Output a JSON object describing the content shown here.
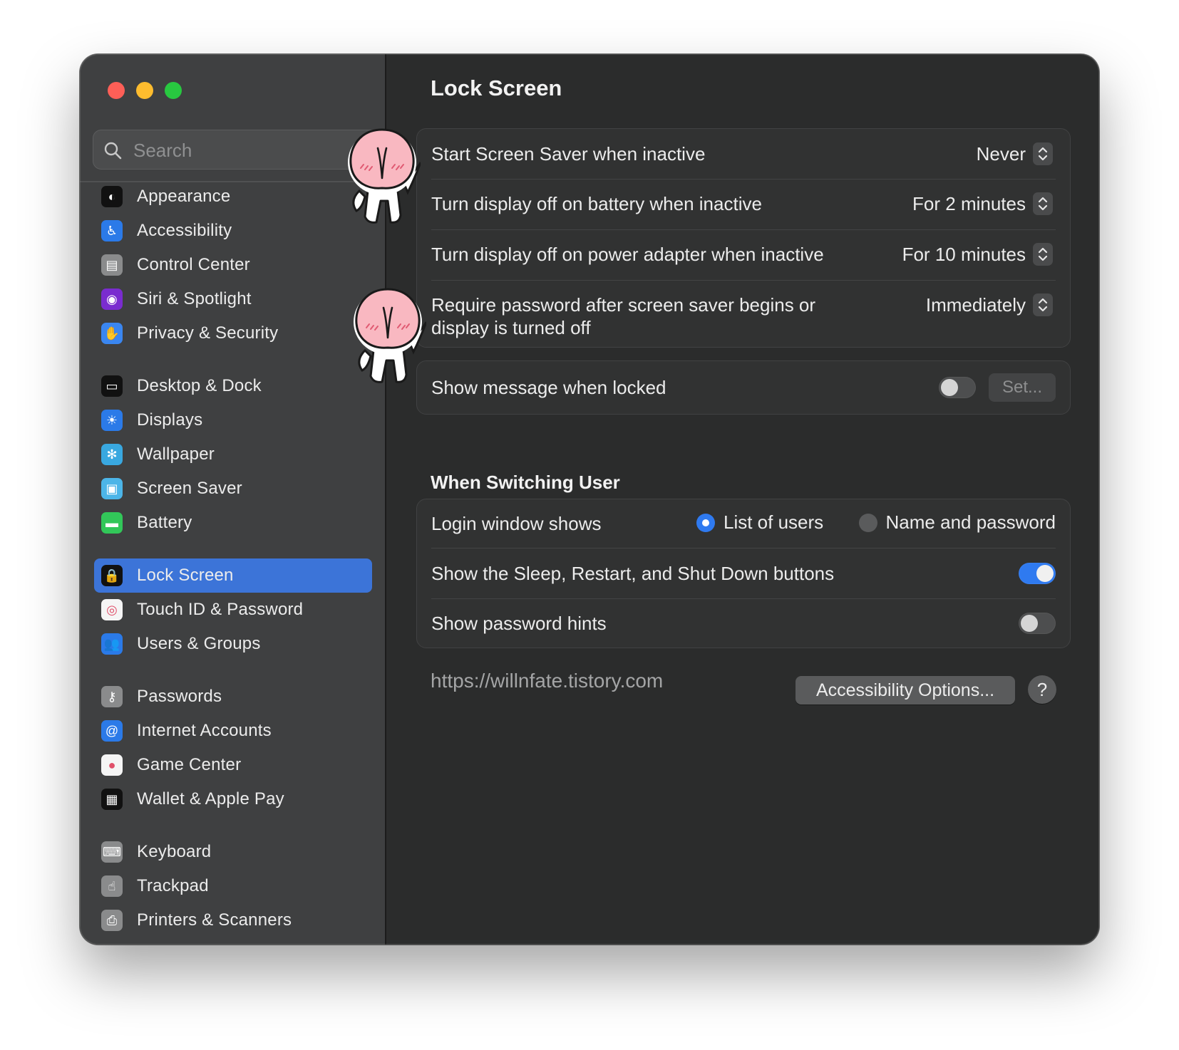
{
  "window": {
    "traffic_lights": [
      "close",
      "minimize",
      "zoom"
    ]
  },
  "sidebar": {
    "search_placeholder": "Search",
    "items": [
      {
        "label": "Appearance",
        "icon": "appearance-icon",
        "color": "#111111"
      },
      {
        "label": "Accessibility",
        "icon": "accessibility-icon",
        "color": "#2b7ae8"
      },
      {
        "label": "Control Center",
        "icon": "control-center-icon",
        "color": "#8a8b8c"
      },
      {
        "label": "Siri & Spotlight",
        "icon": "siri-icon",
        "color": "#7a2ccf"
      },
      {
        "label": "Privacy & Security",
        "icon": "hand-icon",
        "color": "#3a86f0"
      },
      {
        "label": "Desktop & Dock",
        "icon": "dock-icon",
        "color": "#111111"
      },
      {
        "label": "Displays",
        "icon": "sun-icon",
        "color": "#2b7ae8"
      },
      {
        "label": "Wallpaper",
        "icon": "snowflake-icon",
        "color": "#39a8e0"
      },
      {
        "label": "Screen Saver",
        "icon": "screen-saver-icon",
        "color": "#4cb5e8"
      },
      {
        "label": "Battery",
        "icon": "battery-icon",
        "color": "#32c759"
      },
      {
        "label": "Lock Screen",
        "icon": "lock-icon",
        "color": "#111111"
      },
      {
        "label": "Touch ID & Password",
        "icon": "fingerprint-icon",
        "color": "#f5f5f5"
      },
      {
        "label": "Users & Groups",
        "icon": "users-icon",
        "color": "#2b7ae8"
      },
      {
        "label": "Passwords",
        "icon": "key-icon",
        "color": "#8a8b8c"
      },
      {
        "label": "Internet Accounts",
        "icon": "at-icon",
        "color": "#2b7ae8"
      },
      {
        "label": "Game Center",
        "icon": "game-center-icon",
        "color": "#f5f5f5"
      },
      {
        "label": "Wallet & Apple Pay",
        "icon": "wallet-icon",
        "color": "#111111"
      },
      {
        "label": "Keyboard",
        "icon": "keyboard-icon",
        "color": "#8a8b8c"
      },
      {
        "label": "Trackpad",
        "icon": "trackpad-icon",
        "color": "#8a8b8c"
      },
      {
        "label": "Printers & Scanners",
        "icon": "printer-icon",
        "color": "#8a8b8c"
      }
    ],
    "active": "Lock Screen"
  },
  "main": {
    "title": "Lock Screen",
    "settings": [
      {
        "label": "Start Screen Saver when inactive",
        "value": "Never"
      },
      {
        "label": "Turn display off on battery when inactive",
        "value": "For 2 minutes"
      },
      {
        "label": "Turn display off on power adapter when inactive",
        "value": "For 10 minutes"
      },
      {
        "label_line1": "Require password after screen saver begins or",
        "label_line2": "display is turned off",
        "value": "Immediately"
      }
    ],
    "message": {
      "label": "Show message when locked",
      "enabled": false,
      "button": "Set..."
    },
    "switching": {
      "heading": "When Switching User",
      "login_label": "Login window shows",
      "options": [
        "List of users",
        "Name and password"
      ],
      "selected": "List of users",
      "sleep_label": "Show the Sleep, Restart, and Shut Down buttons",
      "sleep_enabled": true,
      "hints_label": "Show password hints",
      "hints_enabled": false
    },
    "footer": {
      "url": "https://willnfate.tistory.com",
      "accessibility_button": "Accessibility Options...",
      "help_button": "?"
    }
  },
  "colors": {
    "accent": "#2f7af0",
    "selection": "#3c74d8",
    "sidebar_bg": "#3f4041",
    "content_bg": "#2b2c2c",
    "sticker_pink": "#f9b8c1"
  }
}
